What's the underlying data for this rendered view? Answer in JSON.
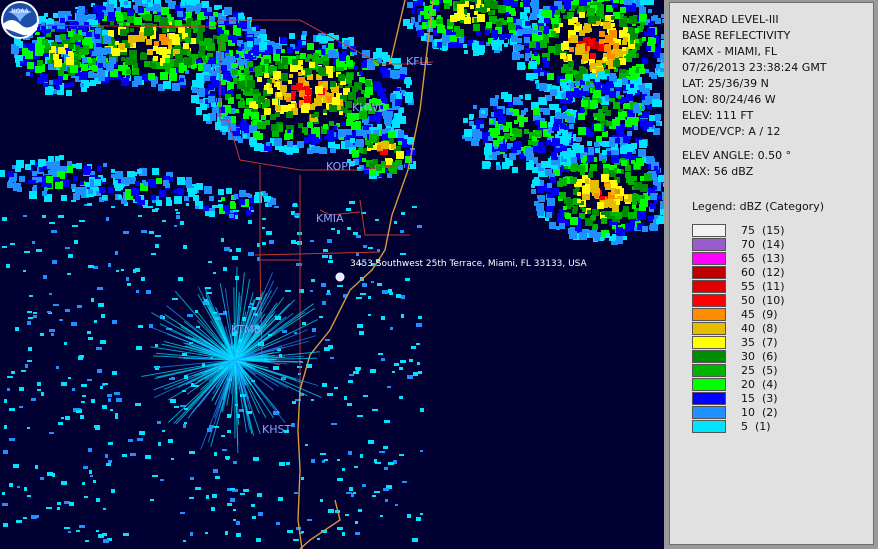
{
  "info": {
    "product": "NEXRAD LEVEL-III",
    "type": "BASE REFLECTIVITY",
    "site": "KAMX - MIAMI, FL",
    "datetime": "07/26/2013 23:38:24 GMT",
    "lat": "LAT: 25/36/39 N",
    "lon": "LON: 80/24/46 W",
    "elev": "ELEV: 111 FT",
    "mode": "MODE/VCP: A / 12",
    "elev_angle": "ELEV ANGLE: 0.50 °",
    "max": "MAX: 56 dBZ"
  },
  "legend": {
    "title": "Legend: dBZ (Category)",
    "entries": [
      {
        "label": "75  (15)",
        "color": "#f2f2f2"
      },
      {
        "label": "70  (14)",
        "color": "#9a5ccd"
      },
      {
        "label": "65  (13)",
        "color": "#ff00ff"
      },
      {
        "label": "60  (12)",
        "color": "#c00000"
      },
      {
        "label": "55  (11)",
        "color": "#e00000"
      },
      {
        "label": "50  (10)",
        "color": "#ff0000"
      },
      {
        "label": "45  (9)",
        "color": "#ff8c00"
      },
      {
        "label": "40  (8)",
        "color": "#e5bc00"
      },
      {
        "label": "35  (7)",
        "color": "#ffff00"
      },
      {
        "label": "30  (6)",
        "color": "#008c00"
      },
      {
        "label": "25  (5)",
        "color": "#00b400"
      },
      {
        "label": "20  (4)",
        "color": "#00ff00"
      },
      {
        "label": "15  (3)",
        "color": "#0000ff"
      },
      {
        "label": "10  (2)",
        "color": "#1e90ff"
      },
      {
        "label": "5  (1)",
        "color": "#00e5ff"
      }
    ]
  },
  "map": {
    "stations": {
      "kfll": "KFLL",
      "khwo": "KHWO",
      "kopf": "KOPF",
      "kmia": "KMIA",
      "ktmb": "KTMB",
      "khst": "KHST"
    },
    "address": "3453 Southwest 25th Terrace, Miami, FL 33133, USA",
    "logo_text": "NOAA"
  }
}
